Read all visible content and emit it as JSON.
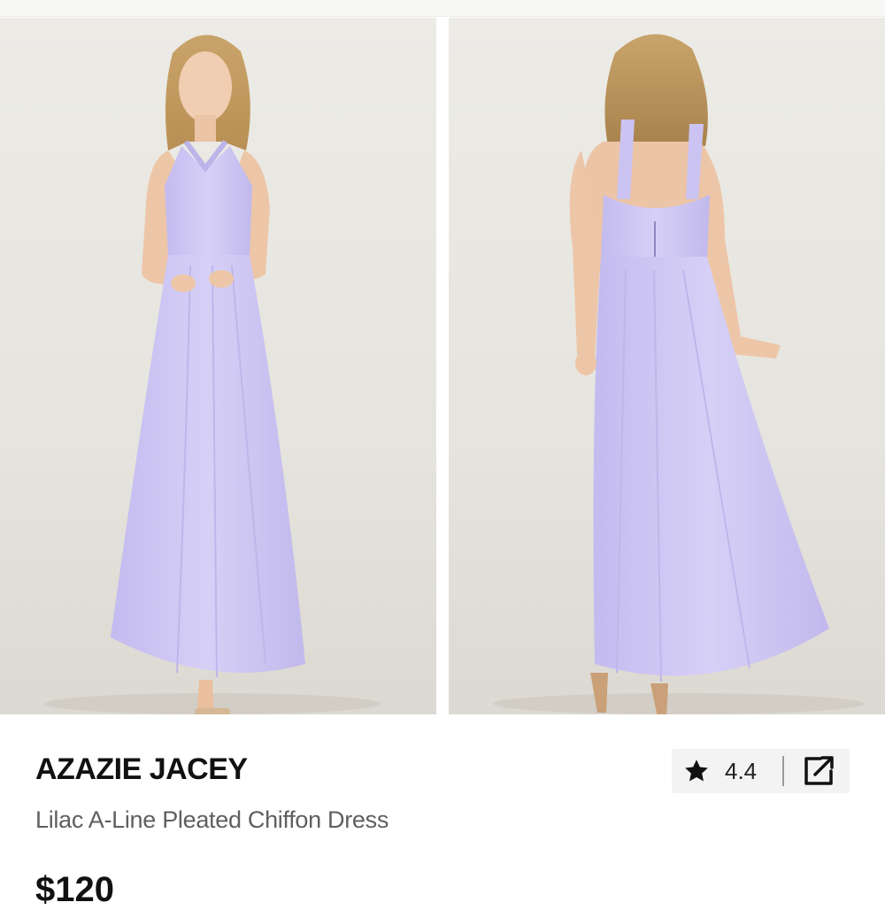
{
  "product": {
    "brand": "AZAZIE JACEY",
    "name": "Lilac A-Line Pleated Chiffon Dress",
    "price": "$120",
    "rating": "4.4"
  },
  "images": [
    {
      "name": "front-view",
      "dress_color": "#cfc8f4"
    },
    {
      "name": "back-view",
      "dress_color": "#cfc8f4"
    }
  ],
  "icons": [
    "star-icon",
    "share-external-icon"
  ],
  "colors": {
    "text": "#111111",
    "subtext": "#5f5f5f",
    "dress": "#cfc8f4",
    "backdrop": "#e8e6e0"
  }
}
